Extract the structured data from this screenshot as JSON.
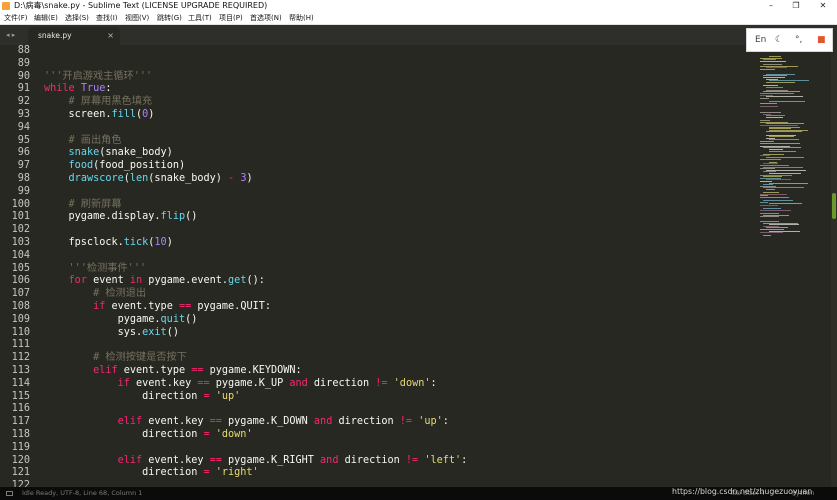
{
  "window": {
    "title": "D:\\病毒\\snake.py - Sublime Text (LICENSE UPGRADE REQUIRED)",
    "minimize": "–",
    "maximize": "❐",
    "close": "✕"
  },
  "menu": [
    "文件(F)",
    "编辑(E)",
    "选择(S)",
    "查找(I)",
    "视图(V)",
    "跳转(G)",
    "工具(T)",
    "项目(P)",
    "首选项(N)",
    "帮助(H)"
  ],
  "tabs": {
    "arrows": "◂ ▸",
    "active": {
      "label": "snake.py",
      "close": "×"
    }
  },
  "ime": {
    "lang": "En",
    "moon": "☾",
    "punct": "°,",
    "grid": "■"
  },
  "editor": {
    "colors": {
      "keyword": "#f92672",
      "builtin": "#66d9ef",
      "number": "#ae81ff",
      "string": "#e6db74",
      "comment": "#75715e",
      "text": "#f8f8f2",
      "background": "#272822"
    },
    "lines": [
      {
        "n": "88",
        "t": []
      },
      {
        "n": "89",
        "t": []
      },
      {
        "n": "90",
        "t": [
          [
            "'''开启游戏主循环'''",
            "comment"
          ]
        ]
      },
      {
        "n": "91",
        "t": [
          [
            "while",
            "keyword"
          ],
          [
            " ",
            "text"
          ],
          [
            "True",
            "number"
          ],
          [
            ":",
            "text"
          ]
        ]
      },
      {
        "n": "92",
        "t": [
          [
            "    # 屏幕用黑色填充",
            "comment"
          ]
        ]
      },
      {
        "n": "93",
        "t": [
          [
            "    screen.",
            "text"
          ],
          [
            "fill",
            "builtin"
          ],
          [
            "(",
            "text"
          ],
          [
            "0",
            "number"
          ],
          [
            ")",
            "text"
          ]
        ]
      },
      {
        "n": "94",
        "t": []
      },
      {
        "n": "95",
        "t": [
          [
            "    # 画出角色",
            "comment"
          ]
        ]
      },
      {
        "n": "96",
        "t": [
          [
            "    ",
            "text"
          ],
          [
            "snake",
            "builtin"
          ],
          [
            "(snake_body)",
            "text"
          ]
        ]
      },
      {
        "n": "97",
        "t": [
          [
            "    ",
            "text"
          ],
          [
            "food",
            "builtin"
          ],
          [
            "(food_position)",
            "text"
          ]
        ]
      },
      {
        "n": "98",
        "t": [
          [
            "    ",
            "text"
          ],
          [
            "drawscore",
            "builtin"
          ],
          [
            "(",
            "text"
          ],
          [
            "len",
            "builtin"
          ],
          [
            "(snake_body) ",
            "text"
          ],
          [
            "-",
            "keyword"
          ],
          [
            " ",
            "text"
          ],
          [
            "3",
            "number"
          ],
          [
            ")",
            "text"
          ]
        ]
      },
      {
        "n": "99",
        "t": []
      },
      {
        "n": "100",
        "t": [
          [
            "    # 刷新屏幕",
            "comment"
          ]
        ]
      },
      {
        "n": "101",
        "t": [
          [
            "    pygame.display.",
            "text"
          ],
          [
            "flip",
            "builtin"
          ],
          [
            "()",
            "text"
          ]
        ]
      },
      {
        "n": "102",
        "t": []
      },
      {
        "n": "103",
        "t": [
          [
            "    fpsclock.",
            "text"
          ],
          [
            "tick",
            "builtin"
          ],
          [
            "(",
            "text"
          ],
          [
            "10",
            "number"
          ],
          [
            ")",
            "text"
          ]
        ]
      },
      {
        "n": "104",
        "t": []
      },
      {
        "n": "105",
        "t": [
          [
            "    '''检测事件'''",
            "comment"
          ]
        ]
      },
      {
        "n": "106",
        "t": [
          [
            "    ",
            "text"
          ],
          [
            "for",
            "keyword"
          ],
          [
            " event ",
            "text"
          ],
          [
            "in",
            "keyword"
          ],
          [
            " pygame.event.",
            "text"
          ],
          [
            "get",
            "builtin"
          ],
          [
            "():",
            "text"
          ]
        ]
      },
      {
        "n": "107",
        "t": [
          [
            "        # 检测退出",
            "comment"
          ]
        ]
      },
      {
        "n": "108",
        "t": [
          [
            "        ",
            "text"
          ],
          [
            "if",
            "keyword"
          ],
          [
            " event.type ",
            "text"
          ],
          [
            "==",
            "keyword"
          ],
          [
            " pygame.QUIT:",
            "text"
          ]
        ]
      },
      {
        "n": "109",
        "t": [
          [
            "            pygame.",
            "text"
          ],
          [
            "quit",
            "builtin"
          ],
          [
            "()",
            "text"
          ]
        ]
      },
      {
        "n": "110",
        "t": [
          [
            "            sys.",
            "text"
          ],
          [
            "exit",
            "builtin"
          ],
          [
            "()",
            "text"
          ]
        ]
      },
      {
        "n": "111",
        "t": []
      },
      {
        "n": "112",
        "t": [
          [
            "        # 检测按键是否按下",
            "comment"
          ]
        ]
      },
      {
        "n": "113",
        "t": [
          [
            "        ",
            "text"
          ],
          [
            "elif",
            "keyword"
          ],
          [
            " event.type ",
            "text"
          ],
          [
            "==",
            "keyword"
          ],
          [
            " pygame.KEYDOWN:",
            "text"
          ]
        ]
      },
      {
        "n": "114",
        "t": [
          [
            "            ",
            "text"
          ],
          [
            "if",
            "keyword"
          ],
          [
            " event.key ",
            "text"
          ],
          [
            "==",
            "keyword"
          ],
          [
            " pygame.K_UP ",
            "text"
          ],
          [
            "and",
            "keyword"
          ],
          [
            " direction ",
            "text"
          ],
          [
            "!=",
            "keyword"
          ],
          [
            " ",
            "text"
          ],
          [
            "'down'",
            "string"
          ],
          [
            ":",
            "text"
          ]
        ]
      },
      {
        "n": "115",
        "t": [
          [
            "                direction ",
            "text"
          ],
          [
            "=",
            "keyword"
          ],
          [
            " ",
            "text"
          ],
          [
            "'up'",
            "string"
          ]
        ]
      },
      {
        "n": "116",
        "t": []
      },
      {
        "n": "117",
        "t": [
          [
            "            ",
            "text"
          ],
          [
            "elif",
            "keyword"
          ],
          [
            " event.key ",
            "text"
          ],
          [
            "==",
            "keyword"
          ],
          [
            " pygame.K_DOWN ",
            "text"
          ],
          [
            "and",
            "keyword"
          ],
          [
            " direction ",
            "text"
          ],
          [
            "!=",
            "keyword"
          ],
          [
            " ",
            "text"
          ],
          [
            "'up'",
            "string"
          ],
          [
            ":",
            "text"
          ]
        ]
      },
      {
        "n": "118",
        "t": [
          [
            "                direction ",
            "text"
          ],
          [
            "=",
            "keyword"
          ],
          [
            " ",
            "text"
          ],
          [
            "'down'",
            "string"
          ]
        ]
      },
      {
        "n": "119",
        "t": []
      },
      {
        "n": "120",
        "t": [
          [
            "            ",
            "text"
          ],
          [
            "elif",
            "keyword"
          ],
          [
            " event.key ",
            "text"
          ],
          [
            "==",
            "keyword"
          ],
          [
            " pygame.K_RIGHT ",
            "text"
          ],
          [
            "and",
            "keyword"
          ],
          [
            " direction ",
            "text"
          ],
          [
            "!=",
            "keyword"
          ],
          [
            " ",
            "text"
          ],
          [
            "'left'",
            "string"
          ],
          [
            ":",
            "text"
          ]
        ]
      },
      {
        "n": "121",
        "t": [
          [
            "                direction ",
            "text"
          ],
          [
            "=",
            "keyword"
          ],
          [
            " ",
            "text"
          ],
          [
            "'right'",
            "string"
          ]
        ]
      },
      {
        "n": "122",
        "t": []
      }
    ]
  },
  "status": {
    "left": "Idle Ready, UTF-8, Line 68, Column 1",
    "tab_size": "Tab Size: 4",
    "syntax": "Python"
  },
  "watermark": "https://blog.csdn.net/zhugezuoyuan"
}
